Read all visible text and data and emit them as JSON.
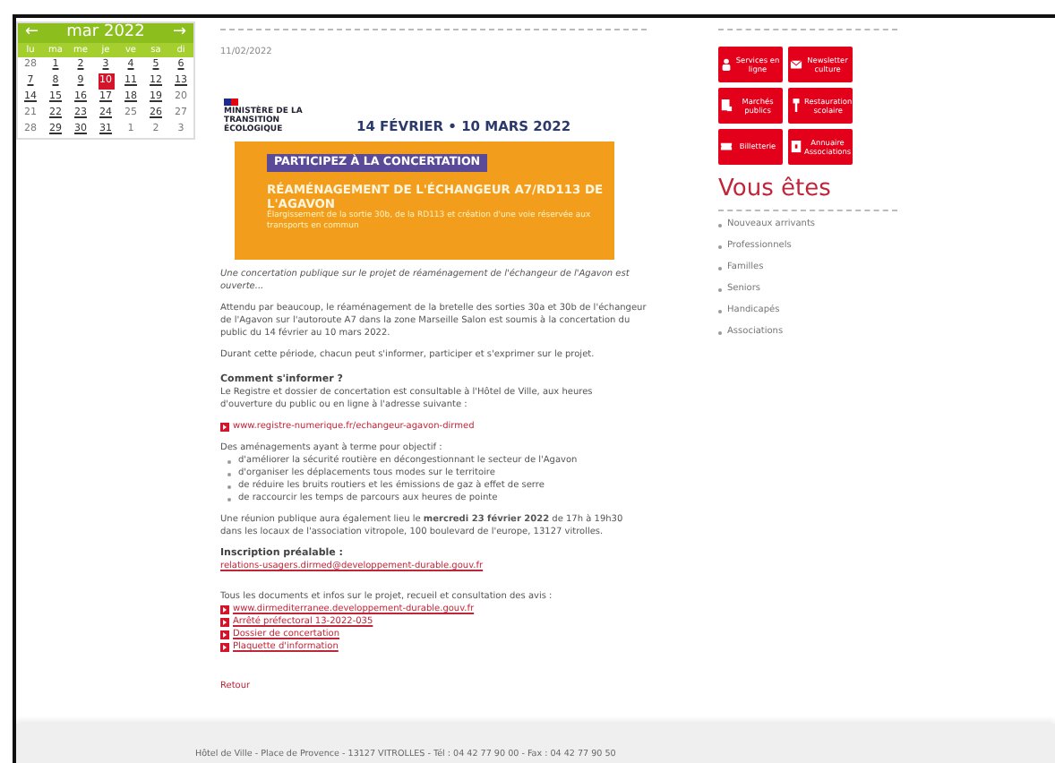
{
  "calendar": {
    "prev": "←",
    "month": "mar 2022",
    "next": "→",
    "weekdays": [
      "lu",
      "ma",
      "me",
      "je",
      "ve",
      "sa",
      "di"
    ],
    "weeks": [
      [
        {
          "day": "28",
          "linked": false,
          "selected": false
        },
        {
          "day": "1",
          "linked": true,
          "selected": false
        },
        {
          "day": "2",
          "linked": true,
          "selected": false
        },
        {
          "day": "3",
          "linked": true,
          "selected": false
        },
        {
          "day": "4",
          "linked": true,
          "selected": false
        },
        {
          "day": "5",
          "linked": true,
          "selected": false
        },
        {
          "day": "6",
          "linked": true,
          "selected": false
        }
      ],
      [
        {
          "day": "7",
          "linked": true,
          "selected": false
        },
        {
          "day": "8",
          "linked": true,
          "selected": false
        },
        {
          "day": "9",
          "linked": true,
          "selected": false
        },
        {
          "day": "10",
          "linked": true,
          "selected": true
        },
        {
          "day": "11",
          "linked": true,
          "selected": false
        },
        {
          "day": "12",
          "linked": true,
          "selected": false
        },
        {
          "day": "13",
          "linked": true,
          "selected": false
        }
      ],
      [
        {
          "day": "14",
          "linked": true,
          "selected": false
        },
        {
          "day": "15",
          "linked": true,
          "selected": false
        },
        {
          "day": "16",
          "linked": true,
          "selected": false
        },
        {
          "day": "17",
          "linked": true,
          "selected": false
        },
        {
          "day": "18",
          "linked": true,
          "selected": false
        },
        {
          "day": "19",
          "linked": true,
          "selected": false
        },
        {
          "day": "20",
          "linked": false,
          "selected": false
        }
      ],
      [
        {
          "day": "21",
          "linked": false,
          "selected": false
        },
        {
          "day": "22",
          "linked": true,
          "selected": false
        },
        {
          "day": "23",
          "linked": true,
          "selected": false
        },
        {
          "day": "24",
          "linked": true,
          "selected": false
        },
        {
          "day": "25",
          "linked": false,
          "selected": false
        },
        {
          "day": "26",
          "linked": true,
          "selected": false
        },
        {
          "day": "27",
          "linked": false,
          "selected": false
        }
      ],
      [
        {
          "day": "28",
          "linked": false,
          "selected": false
        },
        {
          "day": "29",
          "linked": true,
          "selected": false
        },
        {
          "day": "30",
          "linked": true,
          "selected": false
        },
        {
          "day": "31",
          "linked": true,
          "selected": false
        },
        {
          "day": "1",
          "linked": false,
          "selected": false
        },
        {
          "day": "2",
          "linked": false,
          "selected": false
        },
        {
          "day": "3",
          "linked": false,
          "selected": false
        }
      ]
    ]
  },
  "article": {
    "date": "11/02/2022",
    "poster": {
      "ministry": "MINISTÈRE DE LA TRANSITION ÉCOLOGIQUE",
      "dates": "14 FÉVRIER • 10 MARS 2022",
      "tag": "PARTICIPEZ À LA CONCERTATION",
      "title": "RÉAMÉNAGEMENT DE L'ÉCHANGEUR A7/RD113 DE L'AGAVON",
      "subtitle": "Élargissement de la sortie 30b, de la RD113 et création d'une voie réservée aux transports en commun"
    },
    "blocks": [
      {
        "kind": "lead",
        "text": "Une concertation publique sur le projet de réaménagement de l'échangeur de l'Agavon est ouverte..."
      },
      {
        "kind": "text",
        "text": "Attendu par beaucoup, le réaménagement de la bretelle des sorties 30a et 30b de l'échangeur de l'Agavon sur l'autoroute A7 dans la zone Marseille Salon est soumis à la concertation du public du 14 février au 10 mars 2022."
      },
      {
        "kind": "text",
        "text": "Durant cette période, chacun peut s'informer, participer et s'exprimer sur le projet."
      },
      {
        "kind": "section",
        "heading": "Comment s'informer ?",
        "text": "Le Registre et dossier de concertation est consultable à l'Hôtel de Ville, aux heures d'ouverture du public ou en ligne à l'adresse suivante :"
      },
      {
        "kind": "links",
        "items": [
          "www.registre-numerique.fr/echangeur-agavon-dirmed"
        ]
      },
      {
        "kind": "list",
        "intro": "Des aménagements ayant à terme pour objectif :",
        "items": [
          "d'améliorer la sécurité routière en décongestionnant le secteur de l'Agavon",
          "d'organiser les déplacements tous modes sur le territoire",
          "de réduire les bruits routiers et les émissions de gaz à effet de serre",
          "de raccourcir les temps de parcours aux heures de pointe"
        ]
      },
      {
        "kind": "text",
        "text": "Une réunion publique aura également lieu le **mercredi 23 février 2022** de 17h à 19h30 dans les locaux de l'association vitropole, 100 boulevard de l'europe, 13127 vitrolles."
      },
      {
        "kind": "signup",
        "heading": "Inscription préalable :",
        "link": "relations-usagers.dirmed@developpement-durable.gouv.fr"
      },
      {
        "kind": "links",
        "intro": "Tous les documents et infos sur le projet, recueil et consultation des avis :",
        "items": [
          "www.dirmediterranee.developpement-durable.gouv.fr",
          "Arrêté préfectoral 13-2022-035",
          "Dossier de concertation",
          "Plaquette d'information"
        ]
      }
    ],
    "back": "Retour"
  },
  "shortcuts": [
    {
      "label": "Services en ligne",
      "kind": "people"
    },
    {
      "label": "Newsletter culture",
      "kind": "mail"
    },
    {
      "label": "Marchés publics",
      "kind": "doc"
    },
    {
      "label": "Restauration scolaire",
      "kind": "fork"
    },
    {
      "label": "Billetterie",
      "kind": "ticket"
    },
    {
      "label": "Annuaire Associations",
      "kind": "book"
    }
  ],
  "audience": {
    "title": "Vous êtes",
    "items": [
      "Nouveaux arrivants",
      "Professionnels",
      "Familles",
      "Seniors",
      "Handicapés",
      "Associations"
    ]
  },
  "footer": "Hôtel de Ville - Place de Provence - 13127 VITROLLES - Tél : 04 42 77 90 00 - Fax : 04 42 77 90 50"
}
